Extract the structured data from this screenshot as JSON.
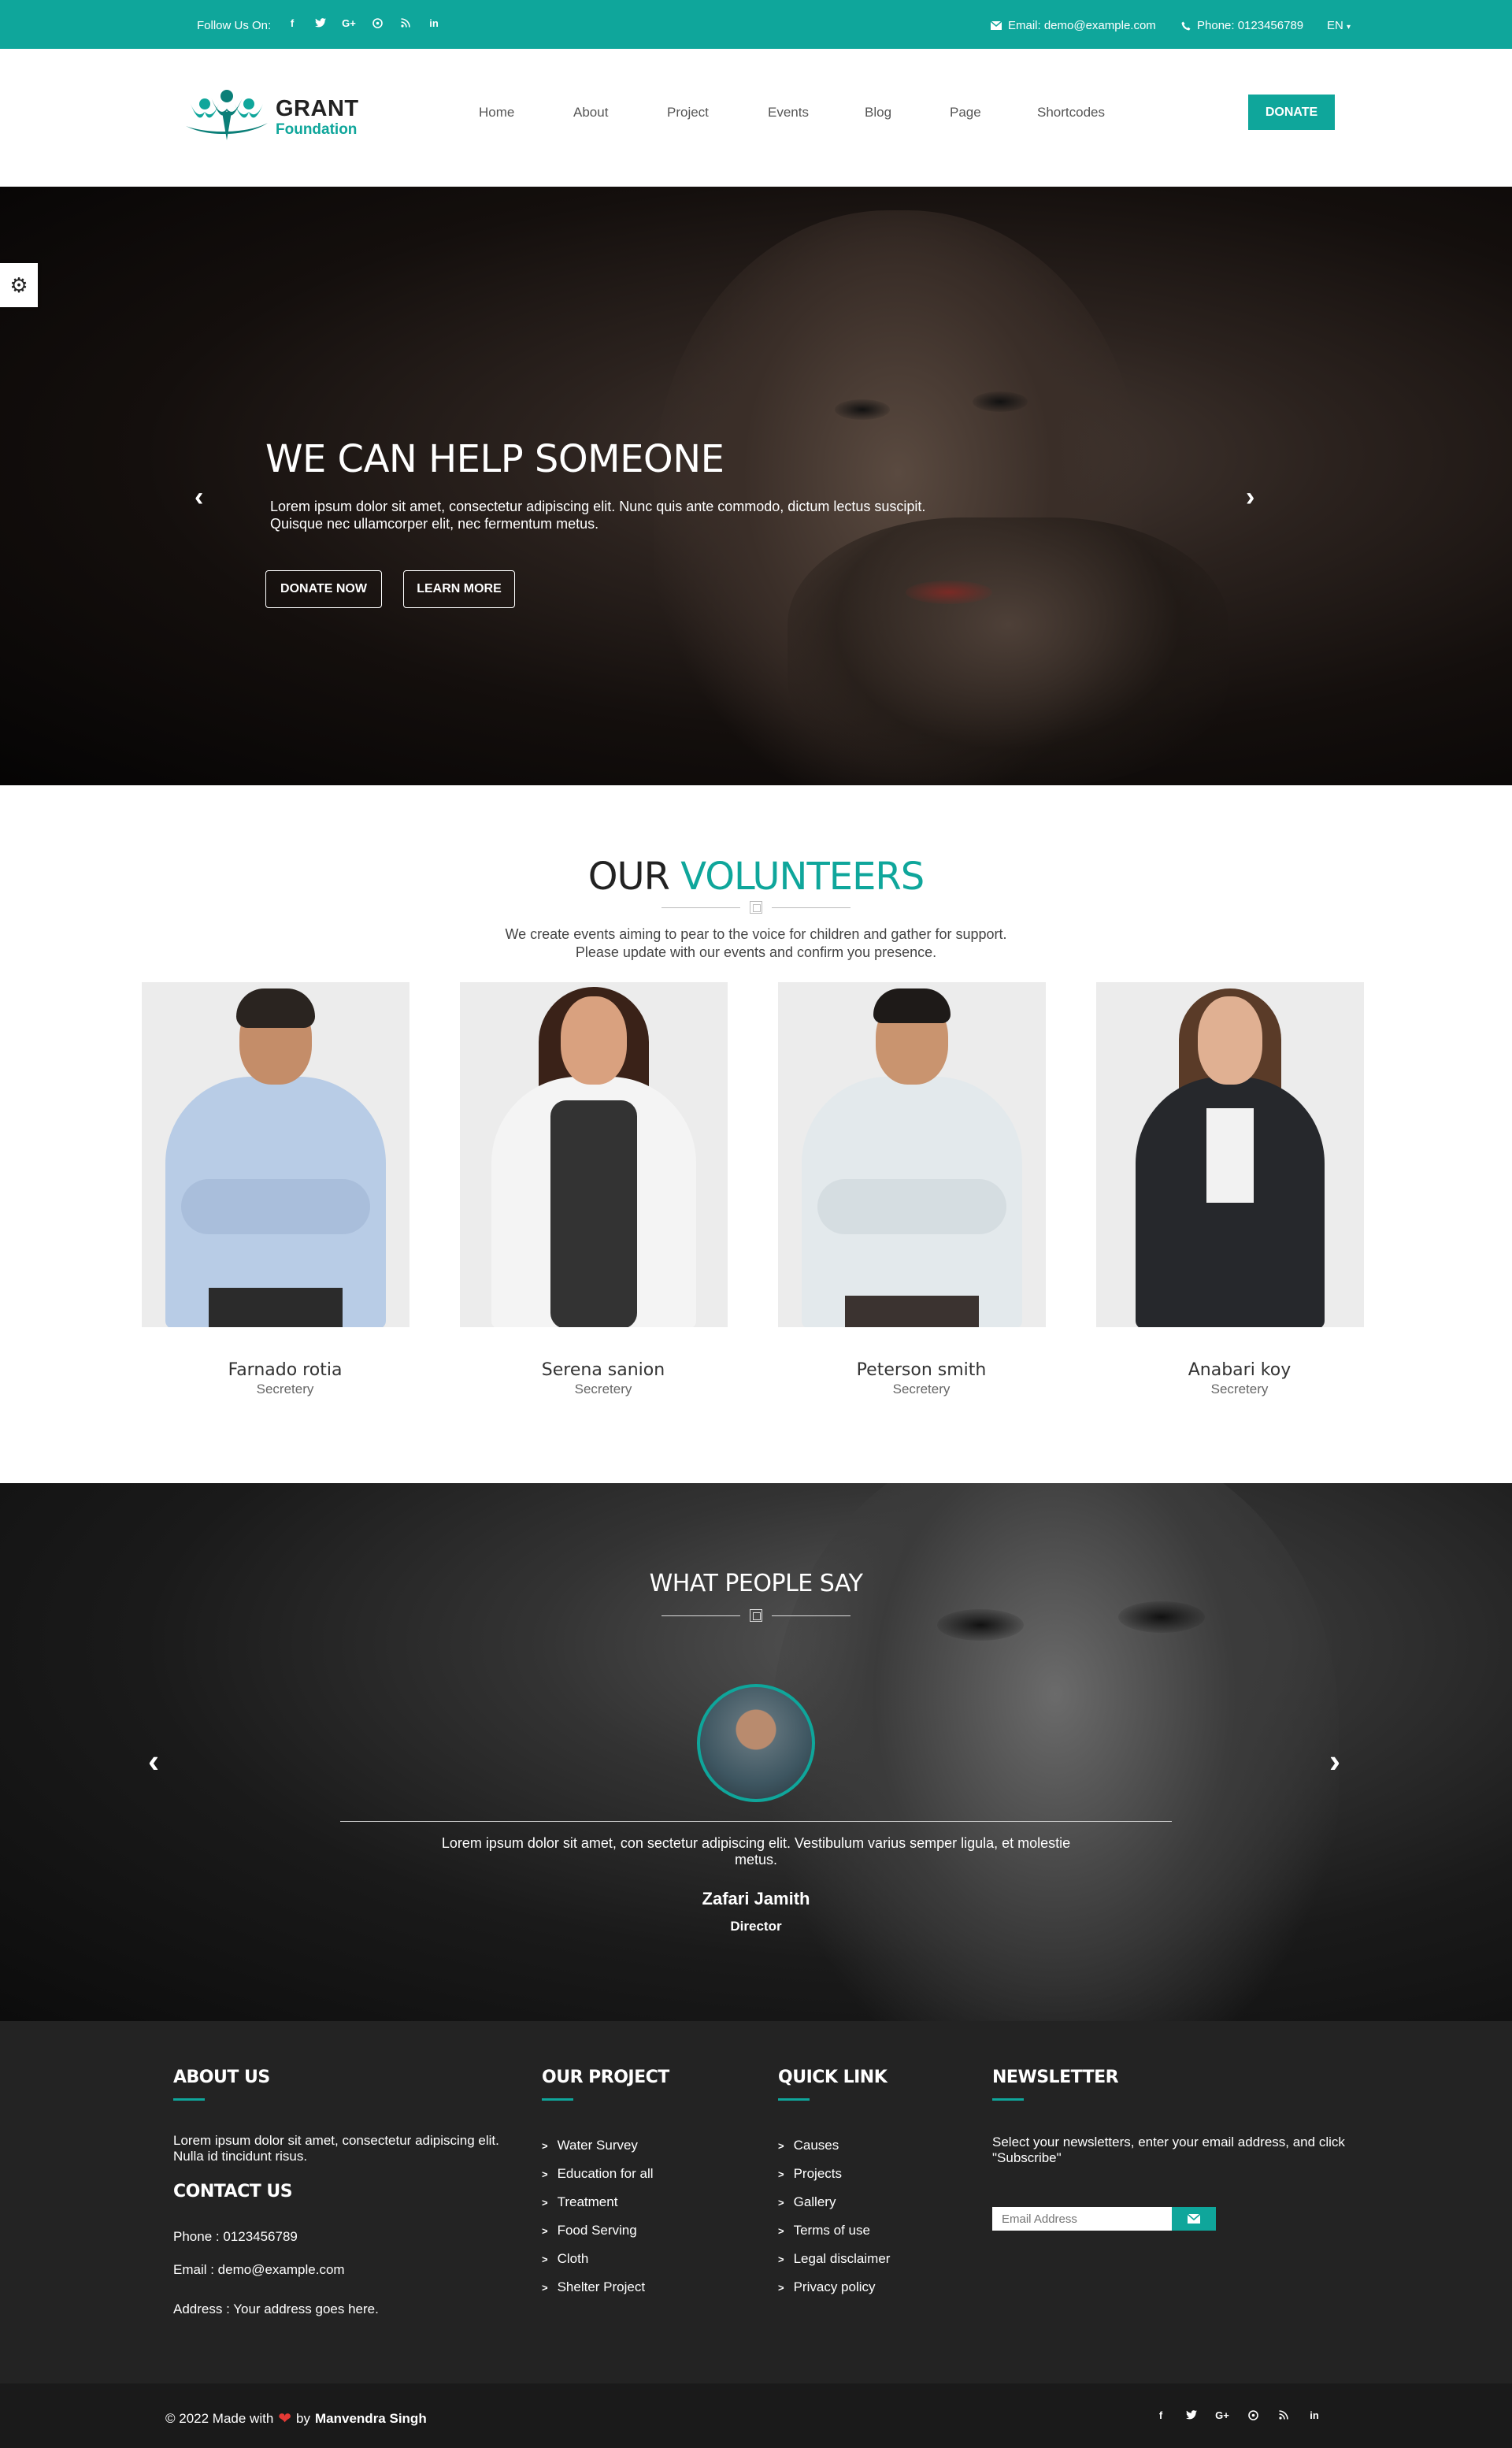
{
  "topbar": {
    "follow_label": "Follow Us On:",
    "socials": [
      "f",
      "t",
      "G+",
      "p",
      "rss",
      "in"
    ],
    "email": "Email: demo@example.com",
    "phone": "Phone: 0123456789",
    "language": "EN"
  },
  "header": {
    "logo_line1": "GRANT",
    "logo_line2": "Foundation",
    "nav": [
      "Home",
      "About",
      "Project",
      "Events",
      "Blog",
      "Page",
      "Shortcodes"
    ],
    "donate_label": "DONATE"
  },
  "hero": {
    "title": "WE CAN HELP SOMEONE",
    "text": "Lorem ipsum dolor sit amet, consectetur adipiscing elit. Nunc quis ante commodo, dictum lectus suscipit. Quisque nec ullamcorper elit, nec fermentum metus.",
    "donate_label": "DONATE NOW",
    "learn_label": "LEARN MORE"
  },
  "volunteers": {
    "title_part1": "OUR",
    "title_part2": "VOLUNTEERS",
    "subtitle_line1": "We create events aiming to pear to the voice for children and gather for support.",
    "subtitle_line2": "Please update with our events and confirm you presence.",
    "members": [
      {
        "name": "Farnado rotia",
        "role": "Secretery"
      },
      {
        "name": "Serena sanion",
        "role": "Secretery"
      },
      {
        "name": "Peterson smith",
        "role": "Secretery"
      },
      {
        "name": "Anabari koy",
        "role": "Secretery"
      }
    ]
  },
  "testimonials": {
    "title": "WHAT PEOPLE SAY",
    "quote": "Lorem ipsum dolor sit amet, con sectetur adipiscing elit. Vestibulum varius semper ligula, et molestie metus.",
    "name": "Zafari Jamith",
    "role": "Director"
  },
  "footer": {
    "about_title": "ABOUT US",
    "about_text": "Lorem ipsum dolor sit amet, consectetur adipiscing elit. Nulla id tincidunt risus.",
    "contact_title": "CONTACT US",
    "phone": "Phone : 0123456789",
    "email": "Email : demo@example.com",
    "address": "Address : Your address goes here.",
    "project_title": "OUR PROJECT",
    "projects": [
      "Water Survey",
      "Education for all",
      "Treatment",
      "Food Serving",
      "Cloth",
      "Shelter Project"
    ],
    "quick_title": "QUICK LINK",
    "quick_links": [
      "Causes",
      "Projects",
      "Gallery",
      "Terms of use",
      "Legal disclaimer",
      "Privacy policy"
    ],
    "newsletter_title": "NEWSLETTER",
    "newsletter_text": "Select your newsletters, enter your email address, and click \"Subscribe\"",
    "newsletter_placeholder": "Email Address"
  },
  "bottombar": {
    "copyright_prefix": "© 2022 Made with",
    "copyright_by": "by",
    "author": "Manvendra Singh",
    "socials": [
      "f",
      "t",
      "G+",
      "p",
      "rss",
      "in"
    ]
  },
  "colors": {
    "accent": "#0fa69b",
    "footer_bg": "#232323",
    "bottombar_bg": "#1a1a1a",
    "heart": "#e53935"
  }
}
